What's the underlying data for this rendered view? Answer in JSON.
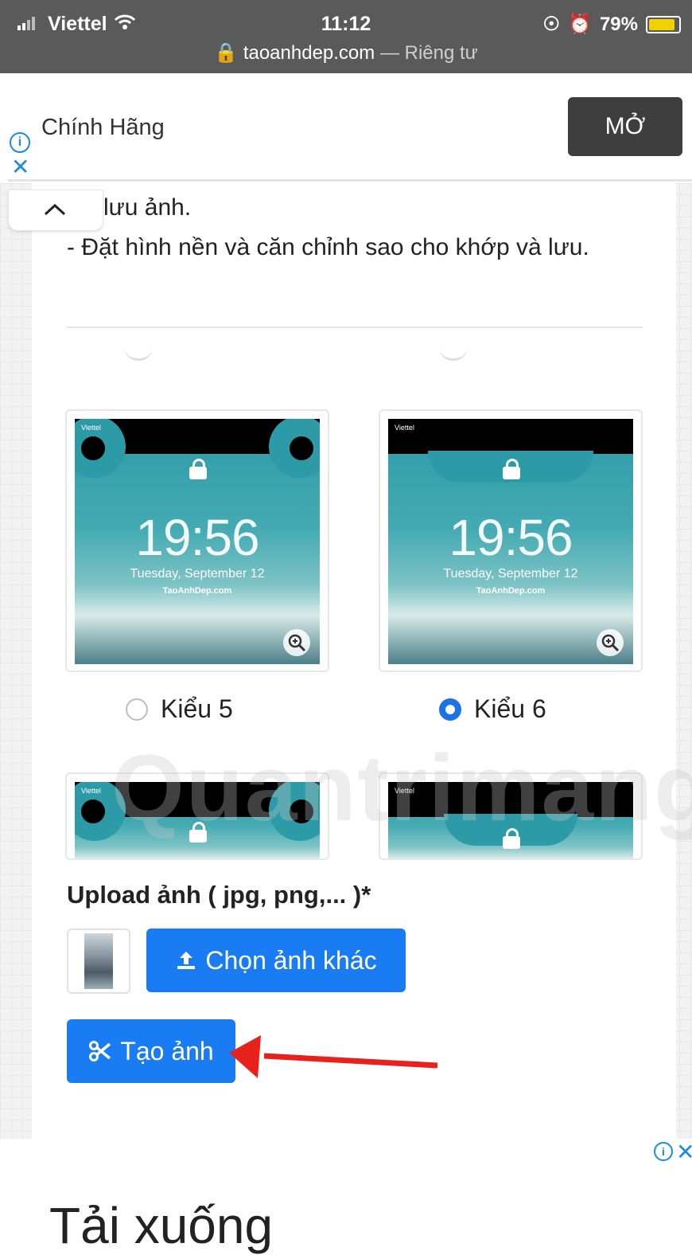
{
  "status_bar": {
    "carrier": "Viettel",
    "time": "11:12",
    "battery_percent": "79%",
    "battery_level": 0.79,
    "url_domain": "taoanhdep.com",
    "url_suffix": "— Riêng tư"
  },
  "top_ad": {
    "text": "Chính Hãng",
    "button_label": "MỞ"
  },
  "instructions": {
    "line1": "lưu ảnh.",
    "line2": "- Đặt hình nền và căn chỉnh sao cho khớp và lưu."
  },
  "styles": [
    {
      "label": "Kiểu 5",
      "selected": false,
      "clock": "19:56",
      "date": "Tuesday, September 12",
      "site": "TaoAnhDep.com",
      "carrier": "Viettel"
    },
    {
      "label": "Kiểu 6",
      "selected": true,
      "clock": "19:56",
      "date": "Tuesday, September 12",
      "site": "TaoAnhDep.com",
      "carrier": "Viettel"
    }
  ],
  "more_styles": [
    {
      "carrier": "Viettel"
    },
    {
      "carrier": "Viettel"
    }
  ],
  "watermark": "Quantrimang",
  "upload": {
    "label": "Upload ảnh ( jpg, png,... )*",
    "choose_button": "Chọn ảnh khác",
    "create_button": "Tạo ảnh"
  },
  "bottom": {
    "heading": "Tải xuống"
  },
  "colors": {
    "accent": "#1a7cf2",
    "annotation_arrow": "#e8211c",
    "status_bar": "#5a5a5a"
  }
}
